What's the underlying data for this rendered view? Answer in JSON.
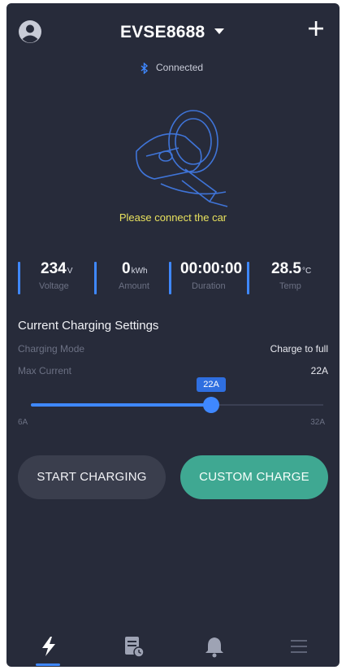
{
  "header": {
    "device_name": "EVSE8688",
    "profile_icon": "user-avatar-icon",
    "dropdown_icon": "caret-down-icon",
    "add_icon": "plus-icon"
  },
  "connection": {
    "status": "Connected",
    "icon": "bluetooth-icon"
  },
  "charger": {
    "message": "Please connect the car",
    "illustration_icon": "ev-charging-plug-icon"
  },
  "stats": {
    "voltage": {
      "value": "234",
      "unit": "V",
      "label": "Voltage"
    },
    "amount": {
      "value": "0",
      "unit": "kWh",
      "label": "Amount"
    },
    "duration": {
      "value": "00:00:00",
      "unit": "",
      "label": "Duration"
    },
    "temp": {
      "value": "28.5",
      "unit": "°C",
      "label": "Temp"
    }
  },
  "settings": {
    "title": "Current Charging Settings",
    "mode_label": "Charging Mode",
    "mode_value": "Charge to full",
    "current_label": "Max Current",
    "current_value": "22A"
  },
  "slider": {
    "min_label": "6A",
    "max_label": "32A",
    "min": 6,
    "max": 32,
    "value": 22,
    "bubble": "22A"
  },
  "buttons": {
    "start": "START CHARGING",
    "custom": "CUSTOM CHARGE"
  },
  "nav": {
    "items": [
      {
        "icon": "lightning-icon",
        "active": true
      },
      {
        "icon": "records-icon",
        "active": false
      },
      {
        "icon": "bell-icon",
        "active": false
      },
      {
        "icon": "menu-icon",
        "active": false
      }
    ]
  },
  "colors": {
    "background": "#272b3a",
    "accent_blue": "#3f88ff",
    "accent_green": "#3fa892",
    "message_yellow": "#e9e25e"
  }
}
